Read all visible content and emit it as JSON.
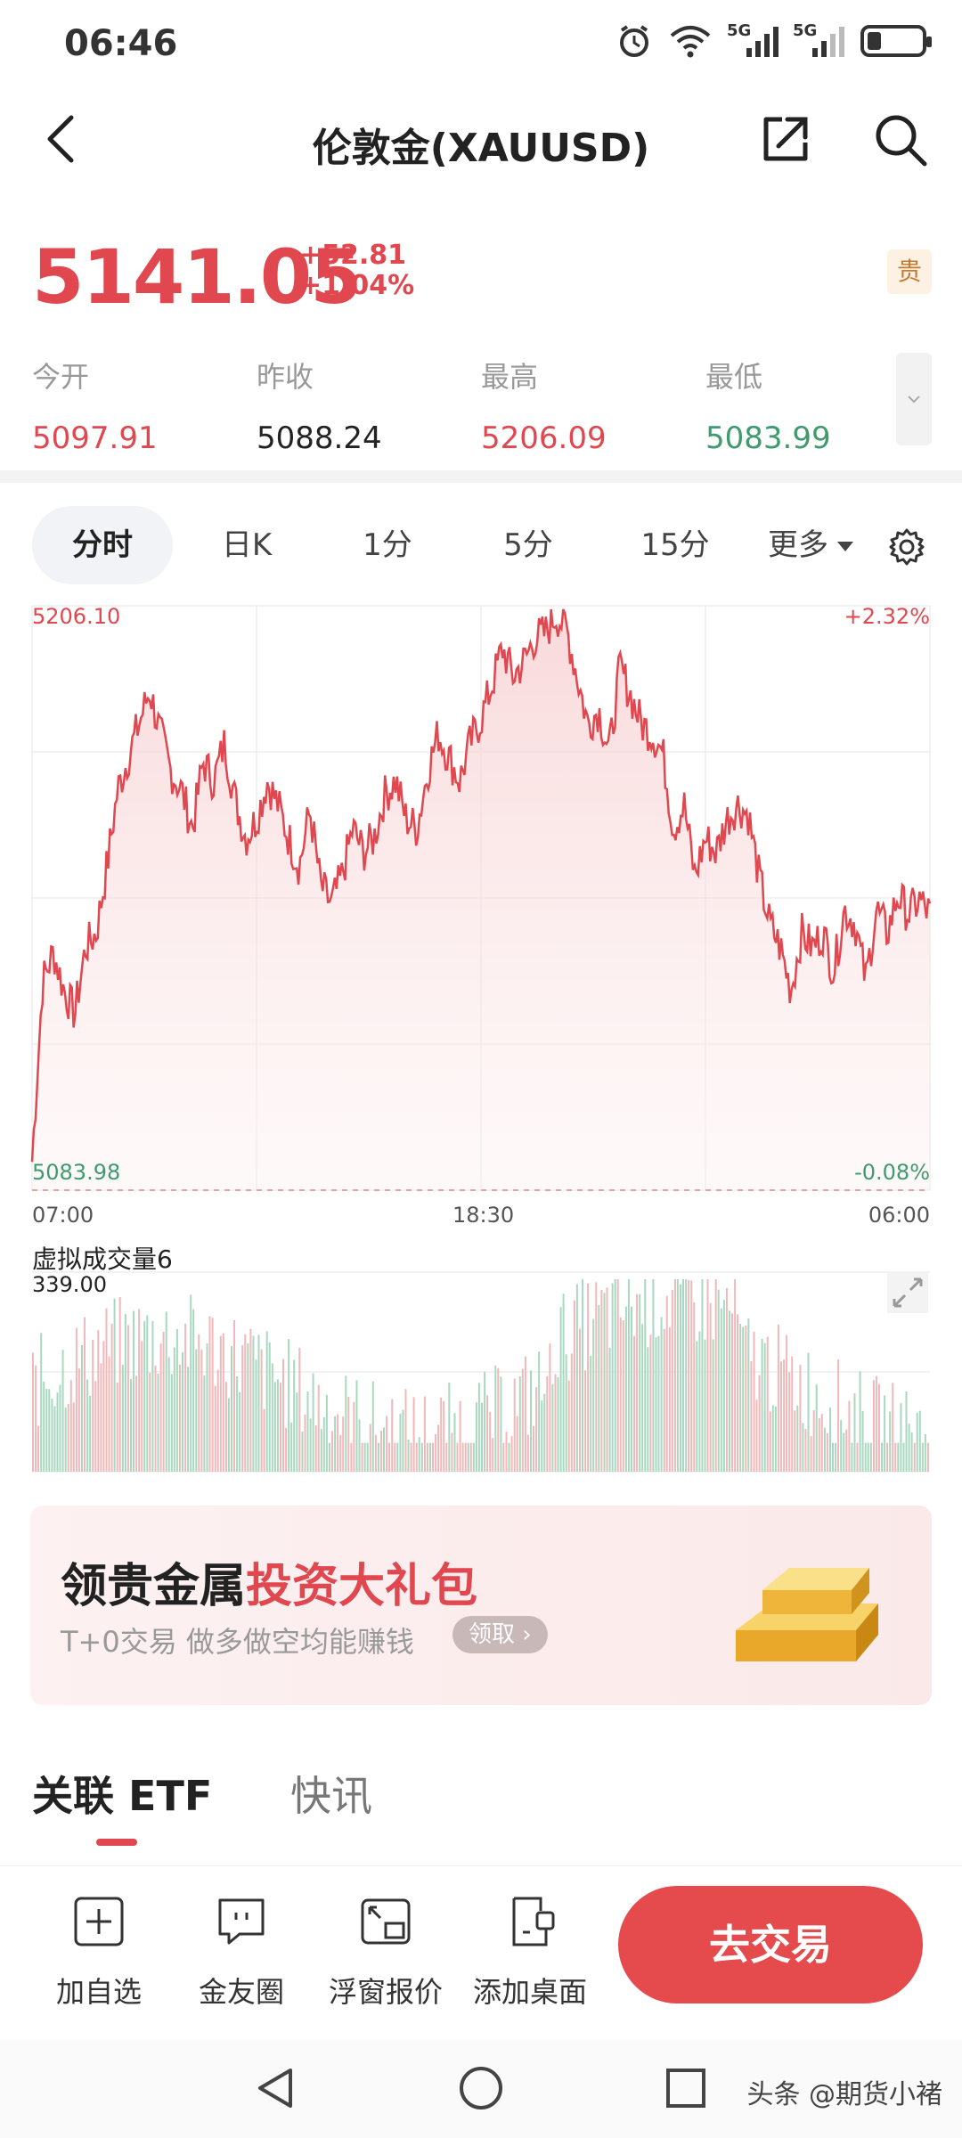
{
  "status": {
    "time": "06:46",
    "signal1": "5G",
    "signal2": "5G",
    "battery_percent": 25
  },
  "header": {
    "title": "伦敦金(XAUUSD)"
  },
  "quote": {
    "price": "5141.05",
    "change": "+52.81",
    "change_pct": "+1.04%",
    "tag": "贵",
    "stats": [
      {
        "label": "今开",
        "value": "5097.91",
        "color": "#e0474f"
      },
      {
        "label": "昨收",
        "value": "5088.24",
        "color": "#222222"
      },
      {
        "label": "最高",
        "value": "5206.09",
        "color": "#e0474f"
      },
      {
        "label": "最低",
        "value": "5083.99",
        "color": "#3f9a6e"
      }
    ]
  },
  "tabs": [
    "分时",
    "日K",
    "1分",
    "5分",
    "15分",
    "更多"
  ],
  "chart_data": {
    "type": "area",
    "y_max_label": "5206.10",
    "y_min_label": "5083.98",
    "pct_max_label": "+2.32%",
    "pct_min_label": "-0.08%",
    "x_labels": [
      "07:00",
      "18:30",
      "06:00"
    ],
    "ylim": [
      5083.98,
      5206.1
    ],
    "series": [
      {
        "values": [
          5090,
          5128,
          5134,
          5126,
          5121,
          5135,
          5138,
          5152,
          5168,
          5175,
          5182,
          5189,
          5180,
          5172,
          5168,
          5160,
          5174,
          5170,
          5178,
          5166,
          5158,
          5162,
          5170,
          5165,
          5158,
          5152,
          5164,
          5148,
          5144,
          5150,
          5160,
          5155,
          5158,
          5167,
          5170,
          5162,
          5160,
          5172,
          5180,
          5175,
          5170,
          5178,
          5183,
          5190,
          5198,
          5192,
          5195,
          5200,
          5201,
          5205,
          5202,
          5192,
          5182,
          5185,
          5176,
          5194,
          5188,
          5182,
          5180,
          5176,
          5160,
          5165,
          5150,
          5158,
          5155,
          5162,
          5165,
          5163,
          5150,
          5140,
          5135,
          5126,
          5138,
          5135,
          5138,
          5130,
          5143,
          5140,
          5128,
          5143,
          5138,
          5146,
          5142,
          5145,
          5142
        ]
      }
    ],
    "volume": {
      "label": "虚拟成交量6",
      "max_label": "339.00"
    },
    "grid": true,
    "line_color": "#e0474f"
  },
  "banner": {
    "title_black": "领贵金属",
    "title_red": "投资大礼包",
    "subtitle": "T+0交易 做多做空均能赚钱",
    "pill": "领取"
  },
  "section_tabs": [
    "关联 ETF",
    "快讯"
  ],
  "toolbar": {
    "items": [
      "加自选",
      "金友圈",
      "浮窗报价",
      "添加桌面"
    ],
    "trade_label": "去交易"
  },
  "watermark": "头条 @期货小褚"
}
